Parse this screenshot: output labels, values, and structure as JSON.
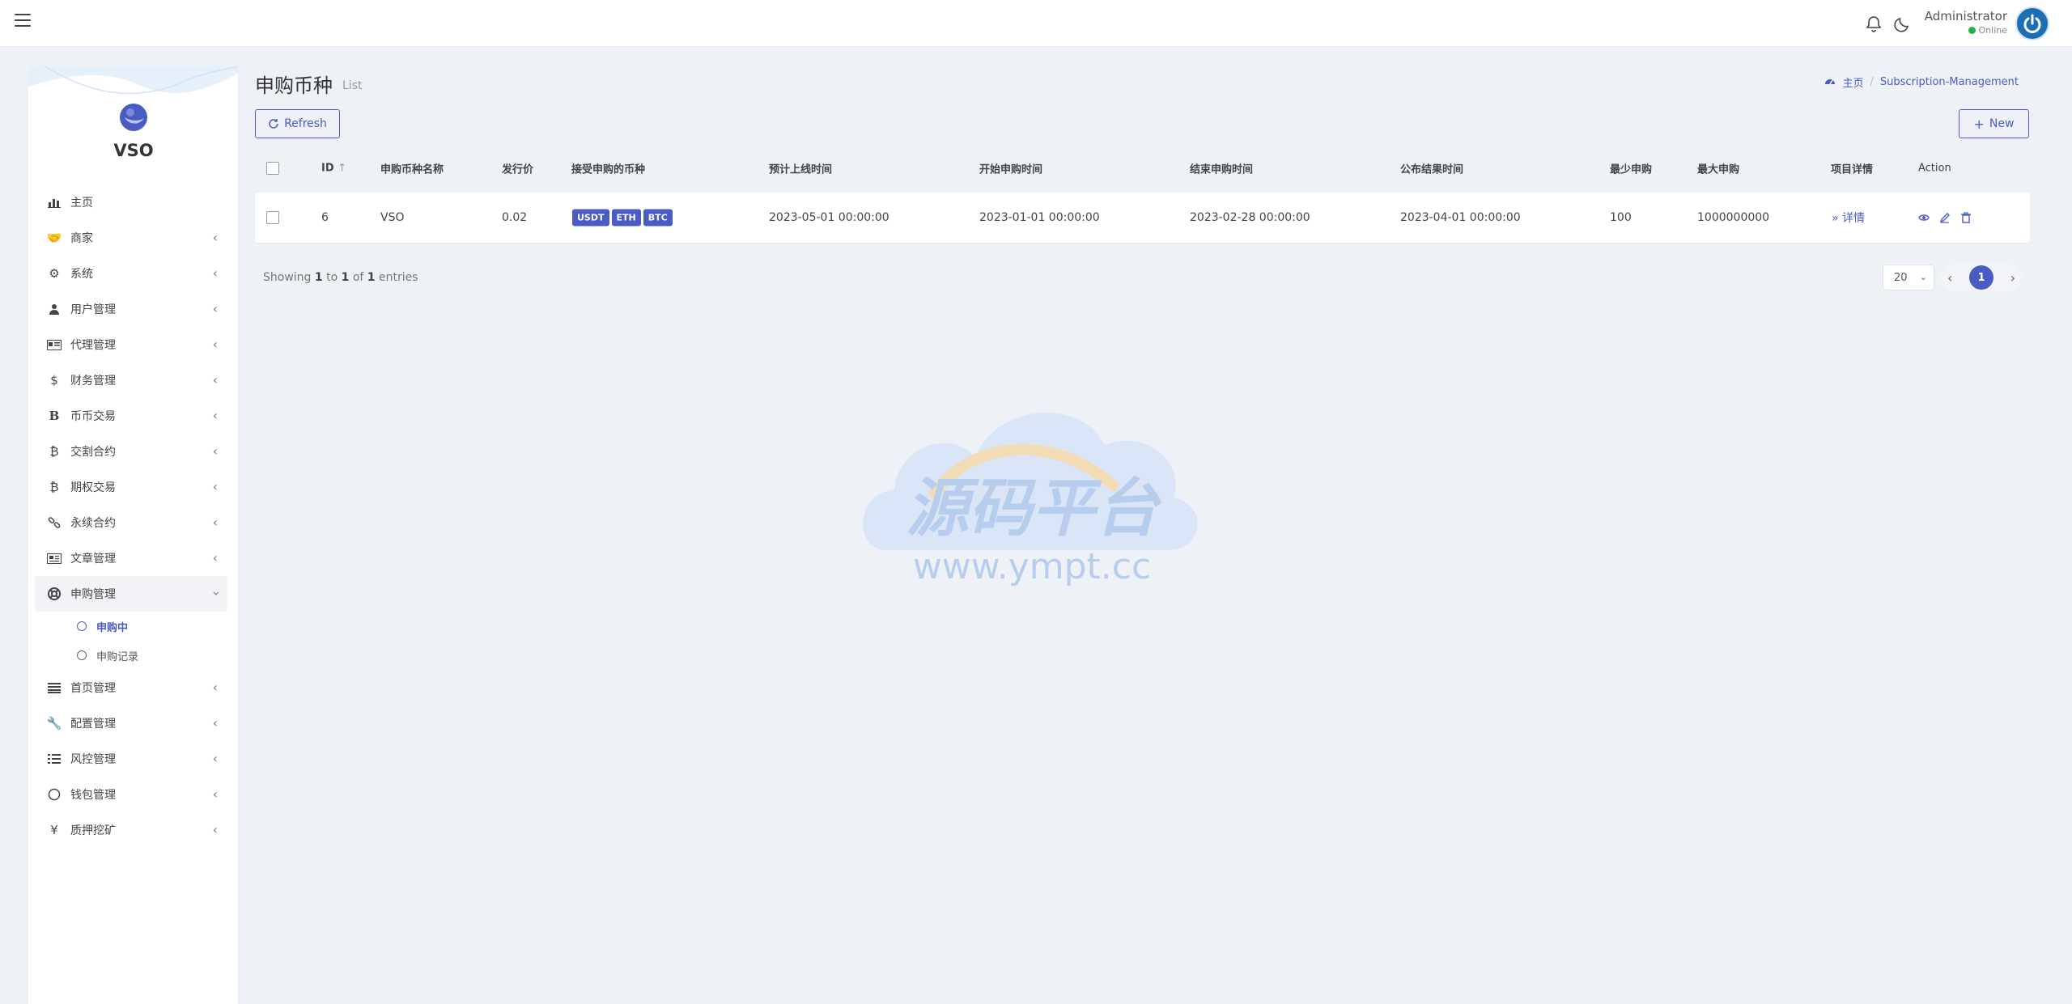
{
  "header": {
    "user_name": "Administrator",
    "user_status": "Online"
  },
  "sidebar": {
    "brand": "VSO",
    "items": [
      {
        "label": "主页",
        "icon": "dashboard-icon",
        "has_children": false
      },
      {
        "label": "商家",
        "icon": "handshake-icon",
        "has_children": true
      },
      {
        "label": "系统",
        "icon": "gear-icon",
        "has_children": true
      },
      {
        "label": "用户管理",
        "icon": "users-icon",
        "has_children": true
      },
      {
        "label": "代理管理",
        "icon": "id-card-icon",
        "has_children": true
      },
      {
        "label": "财务管理",
        "icon": "dollar-icon",
        "has_children": true
      },
      {
        "label": "币币交易",
        "icon": "bold-b-icon",
        "has_children": true
      },
      {
        "label": "交割合约",
        "icon": "bitcoin-icon",
        "has_children": true
      },
      {
        "label": "期权交易",
        "icon": "bitcoin-icon",
        "has_children": true
      },
      {
        "label": "永续合约",
        "icon": "link-icon",
        "has_children": true
      },
      {
        "label": "文章管理",
        "icon": "newspaper-icon",
        "has_children": true
      },
      {
        "label": "申购管理",
        "icon": "lifebuoy-icon",
        "has_children": true,
        "expanded": true
      },
      {
        "label": "首页管理",
        "icon": "list-icon",
        "has_children": true
      },
      {
        "label": "配置管理",
        "icon": "wrench-icon",
        "has_children": true
      },
      {
        "label": "风控管理",
        "icon": "list-alt-icon",
        "has_children": true
      },
      {
        "label": "钱包管理",
        "icon": "circle-icon",
        "has_children": true
      },
      {
        "label": "质押挖矿",
        "icon": "yen-icon",
        "has_children": true
      }
    ],
    "subitems": [
      {
        "label": "申购中",
        "current": true
      },
      {
        "label": "申购记录",
        "current": false
      }
    ]
  },
  "page": {
    "title": "申购币种",
    "subtitle": "List",
    "breadcrumb": {
      "home": "主页",
      "current": "Subscription-Management"
    },
    "refresh_label": "Refresh",
    "new_label": "New"
  },
  "table": {
    "columns": [
      "ID",
      "申购币种名称",
      "发行价",
      "接受申购的币种",
      "预计上线时间",
      "开始申购时间",
      "结束申购时间",
      "公布结果时间",
      "最少申购",
      "最大申购",
      "项目详情",
      "Action"
    ],
    "rows": [
      {
        "id": "6",
        "name": "VSO",
        "price": "0.02",
        "currencies": [
          "USDT",
          "ETH",
          "BTC"
        ],
        "listing_time": "2023-05-01 00:00:00",
        "start_time": "2023-01-01 00:00:00",
        "end_time": "2023-02-28 00:00:00",
        "result_time": "2023-04-01 00:00:00",
        "min": "100",
        "max": "1000000000",
        "detail": "详情"
      }
    ]
  },
  "footer": {
    "showing_prefix": "Showing",
    "from": "1",
    "to_word": "to",
    "to": "1",
    "of_word": "of",
    "total": "1",
    "entries_word": "entries",
    "page_size": "20",
    "current_page": "1"
  },
  "watermark": {
    "title": "源码平台",
    "url": "www.ympt.cc"
  },
  "colors": {
    "accent": "#4b5bc4",
    "online": "#22b14c",
    "avatar": "#1c6fb5"
  }
}
